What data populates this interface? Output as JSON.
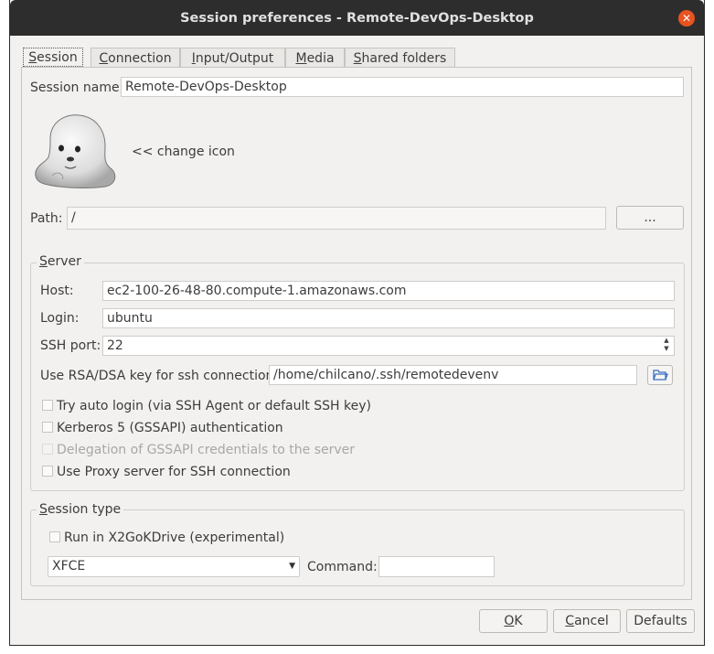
{
  "window": {
    "title": "Session preferences - Remote-DevOps-Desktop"
  },
  "tabs": [
    {
      "pre": "",
      "key": "S",
      "post": "ession"
    },
    {
      "pre": "",
      "key": "C",
      "post": "onnection"
    },
    {
      "pre": "",
      "key": "I",
      "post": "nput/Output"
    },
    {
      "pre": "",
      "key": "M",
      "post": "edia"
    },
    {
      "pre": "",
      "key": "S",
      "post": "hared folders"
    }
  ],
  "session": {
    "name_label": "Session name:",
    "name_value": "Remote-DevOps-Desktop",
    "change_icon_label": "<< change icon",
    "path_label": "Path:",
    "path_value": "/",
    "path_button": "..."
  },
  "server": {
    "group_key": "S",
    "group_rest": "erver",
    "host_label": "Host:",
    "host_value": "ec2-100-26-48-80.compute-1.amazonaws.com",
    "login_label": "Login:",
    "login_value": "ubuntu",
    "ssh_port_label": "SSH port:",
    "ssh_port_value": "22",
    "rsa_label": "Use RSA/DSA key for ssh connection:",
    "rsa_value": "/home/chilcano/.ssh/remotedevenv",
    "checks": [
      {
        "label": "Try auto login (via SSH Agent or default SSH key)",
        "checked": false,
        "disabled": false
      },
      {
        "label": "Kerberos 5 (GSSAPI) authentication",
        "checked": false,
        "disabled": false
      },
      {
        "label": "Delegation of GSSAPI credentials to the server",
        "checked": false,
        "disabled": true
      },
      {
        "label": "Use Proxy server for SSH connection",
        "checked": false,
        "disabled": false
      }
    ]
  },
  "session_type": {
    "group_key": "S",
    "group_rest": "ession type",
    "x2gokdrive_label": "Run in X2GoKDrive (experimental)",
    "type_value": "XFCE",
    "command_label": "Command:",
    "command_value": ""
  },
  "buttons": {
    "ok_key": "O",
    "ok_rest": "K",
    "cancel_key": "C",
    "cancel_rest": "ancel",
    "defaults": "Defaults"
  },
  "colors": {
    "titlebar": "#2d2d2d",
    "close": "#e95420",
    "dialog_bg": "#f2f1f0"
  }
}
